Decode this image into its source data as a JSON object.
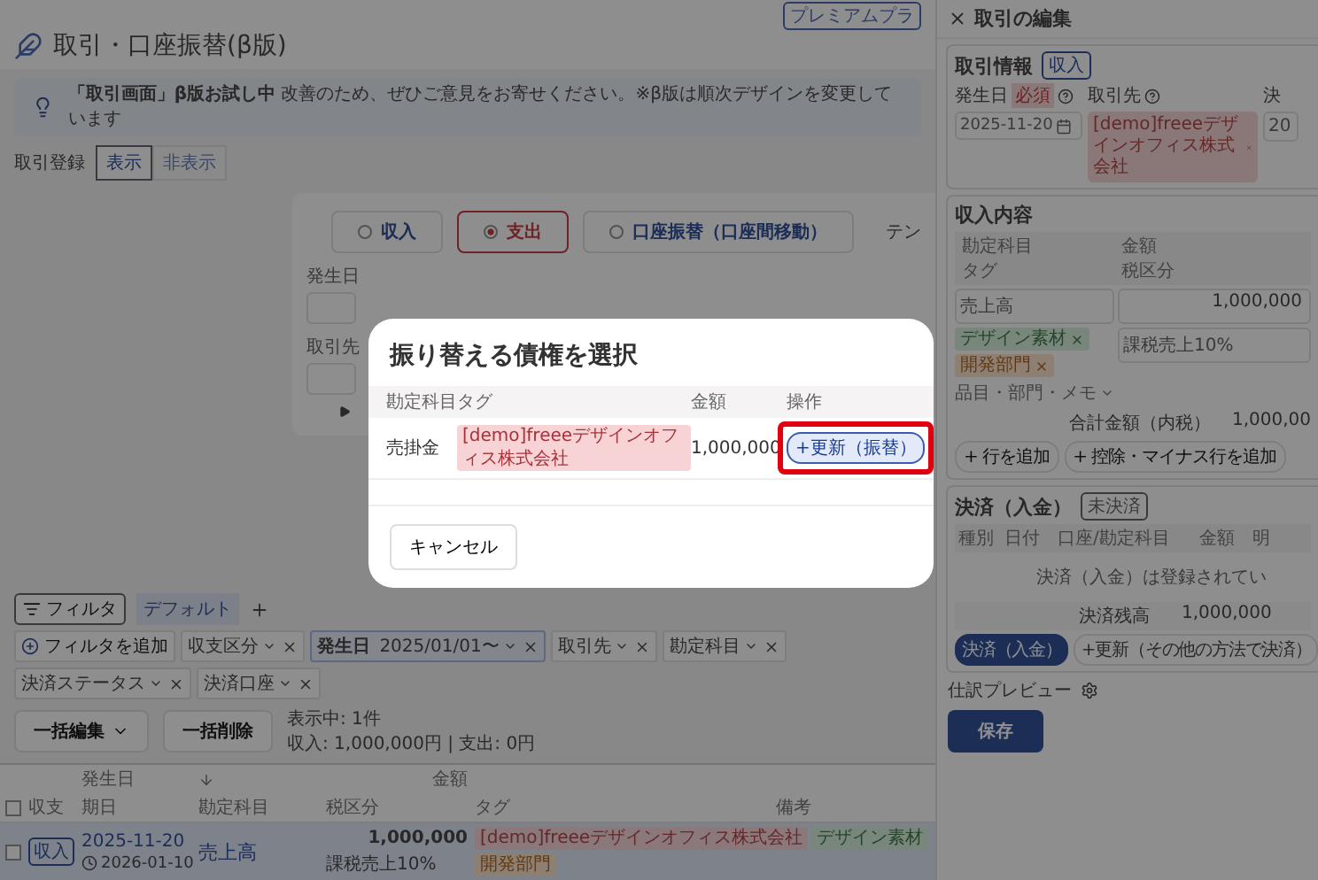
{
  "top_badge": "プレミアムプラ",
  "page_title": "取引・口座振替(β版)",
  "banner": {
    "title": "「取引画面」β版お試し中",
    "message": "改善のため、ぜひご意見をお寄せください。※β版は順次デザインを変更しています"
  },
  "register_toggle": {
    "label": "取引登録",
    "options": [
      {
        "label": "表示",
        "selected": true
      },
      {
        "label": "非表示",
        "selected": false
      }
    ]
  },
  "entry_form": {
    "types": [
      {
        "label": "収入",
        "selected": false
      },
      {
        "label": "支出",
        "selected": true
      },
      {
        "label": "口座振替（口座間移動）",
        "selected": false
      }
    ],
    "side_label": "テン",
    "fields": [
      {
        "label": "発生日"
      },
      {
        "label": "取引先"
      }
    ]
  },
  "filters": {
    "button": "フィルタ",
    "views": [
      {
        "label": "デフォルト",
        "selected": true
      }
    ],
    "add_filter": "フィルタを追加",
    "chips": [
      {
        "label": "収支区分",
        "active": false
      },
      {
        "label": "発生日",
        "value": "2025/01/01〜",
        "active": true
      },
      {
        "label": "取引先",
        "active": false
      },
      {
        "label": "勘定科目",
        "active": false
      },
      {
        "label": "決済ステータス",
        "active": false
      },
      {
        "label": "決済口座",
        "active": false
      }
    ]
  },
  "bulk": {
    "buttons": [
      {
        "label": "一括編集",
        "kind": "menu"
      },
      {
        "label": "一括削除",
        "kind": "plain"
      }
    ],
    "count": "表示中: 1件",
    "totals": "収入: 1,000,000円 | 支出: 0円"
  },
  "table": {
    "group_headers": [
      "発生日",
      "金額"
    ],
    "columns": [
      "収支",
      "期日",
      "勘定科目",
      "税区分",
      "タグ",
      "備考"
    ],
    "header_checked": false,
    "rows": [
      {
        "selected": true,
        "checked": false,
        "type": "収入",
        "date": "2025-11-20",
        "due": "2026-01-10",
        "account": "売上高",
        "amount": "1,000,000",
        "tax": "課税売上10%",
        "tags": [
          {
            "label": "[demo]freeeデザインオフィス株式会社",
            "kind": "partner"
          },
          {
            "label": "デザイン素材",
            "kind": "item"
          },
          {
            "label": "開発部門",
            "kind": "department"
          }
        ]
      }
    ]
  },
  "edit_panel": {
    "title": "取引の編集",
    "info": {
      "heading": "取引情報",
      "type_badge": "収入",
      "fields": [
        {
          "label": "発生日",
          "required": "必須",
          "help": true,
          "value": "2025-11-20",
          "kind": "date"
        },
        {
          "label": "取引先",
          "help": true,
          "value": "[demo]freeeデザインオフィス株式会社",
          "kind": "partner"
        },
        {
          "label": "決",
          "help": false,
          "value": "20",
          "kind": "text"
        }
      ]
    },
    "content": {
      "heading": "収入内容",
      "header_cells": [
        "勘定科目",
        "金額",
        "タグ",
        "税区分"
      ],
      "line": {
        "account": "売上高",
        "amount": "1,000,000",
        "tax": "課税売上10%",
        "tags": [
          {
            "label": "デザイン素材",
            "kind": "item"
          },
          {
            "label": "開発部門",
            "kind": "department"
          }
        ],
        "details_toggle": "品目・部門・メモ"
      },
      "total_label": "合計金額（内税）",
      "total_value": "1,000,00",
      "add_buttons": [
        "+ 行を追加",
        "+ 控除・マイナス行を追加"
      ]
    },
    "payment": {
      "heading": "決済（入金）",
      "status": "未決済",
      "columns": [
        "種別",
        "日付",
        "口座/勘定科目",
        "金額",
        "明"
      ],
      "empty": "決済（入金）は登録されてい",
      "balance_label": "決済残高",
      "balance_value": "1,000,000",
      "buttons": [
        {
          "label": "決済（入金）",
          "kind": "primary"
        },
        {
          "label": "+更新（その他の方法で決済）",
          "kind": "secondary"
        }
      ]
    },
    "preview_label": "仕訳プレビュー",
    "save": "保存"
  },
  "modal": {
    "title": "振り替える債権を選択",
    "columns": [
      "勘定科目",
      "タグ",
      "金額",
      "操作"
    ],
    "rows": [
      {
        "account": "売掛金",
        "tag": {
          "label": "[demo]freeeデザインオフィス株式会社",
          "kind": "partner"
        },
        "amount": "1,000,000",
        "action": "+更新（振替）",
        "highlighted": true
      }
    ],
    "cancel": "キャンセル"
  }
}
